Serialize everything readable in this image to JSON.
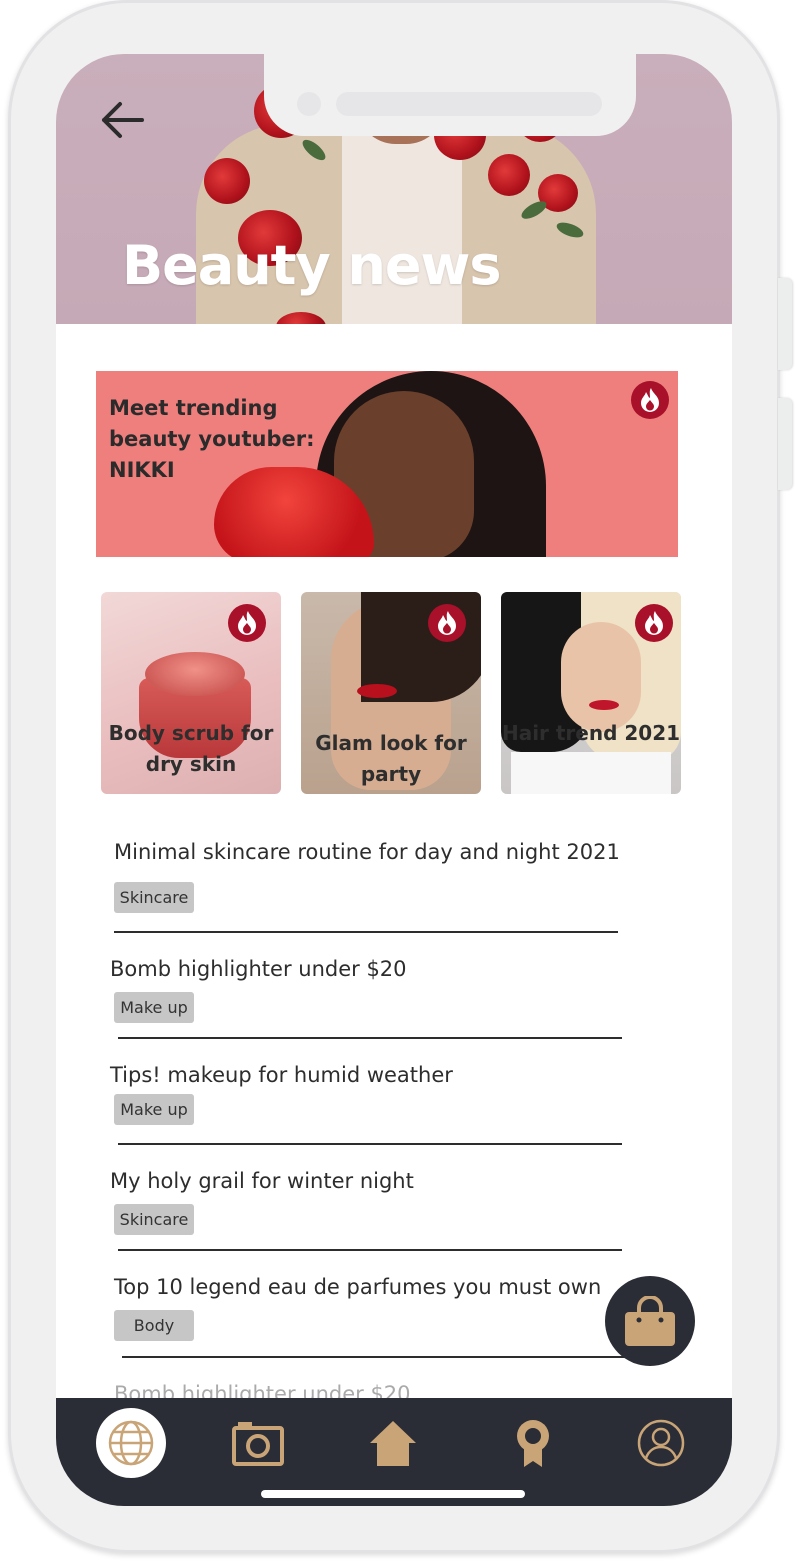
{
  "header": {
    "title": "Beauty news",
    "back_icon": "arrow-left-icon"
  },
  "featured": {
    "title": "Meet trending beauty youtuber: NIKKI",
    "badge_icon": "fire-icon"
  },
  "cards": [
    {
      "title": "Body scrub for dry skin",
      "badge_icon": "fire-icon"
    },
    {
      "title": "Glam look for party",
      "badge_icon": "fire-icon"
    },
    {
      "title": "Hair trend 2021",
      "badge_icon": "fire-icon"
    }
  ],
  "articles": [
    {
      "title": "Minimal skincare routine for day and night 2021",
      "tag": "Skincare"
    },
    {
      "title": "Bomb highlighter under $20",
      "tag": "Make up"
    },
    {
      "title": "Tips! makeup for humid weather",
      "tag": "Make up"
    },
    {
      "title": "My holy grail for winter night",
      "tag": "Skincare"
    },
    {
      "title": "Top 10 legend eau de parfumes you must own",
      "tag": "Body"
    },
    {
      "title": "Bomb highlighter under $20"
    }
  ],
  "cart_icon": "shopping-bag-icon",
  "nav": [
    {
      "icon": "globe-icon",
      "active": true
    },
    {
      "icon": "camera-icon",
      "active": false
    },
    {
      "icon": "home-icon",
      "active": false
    },
    {
      "icon": "award-icon",
      "active": false
    },
    {
      "icon": "user-icon",
      "active": false
    }
  ],
  "colors": {
    "accent_gold": "#c9a477",
    "nav_dark": "#2b2d36",
    "badge_red": "#a9102a",
    "tag_gray": "#c6c6c6"
  }
}
